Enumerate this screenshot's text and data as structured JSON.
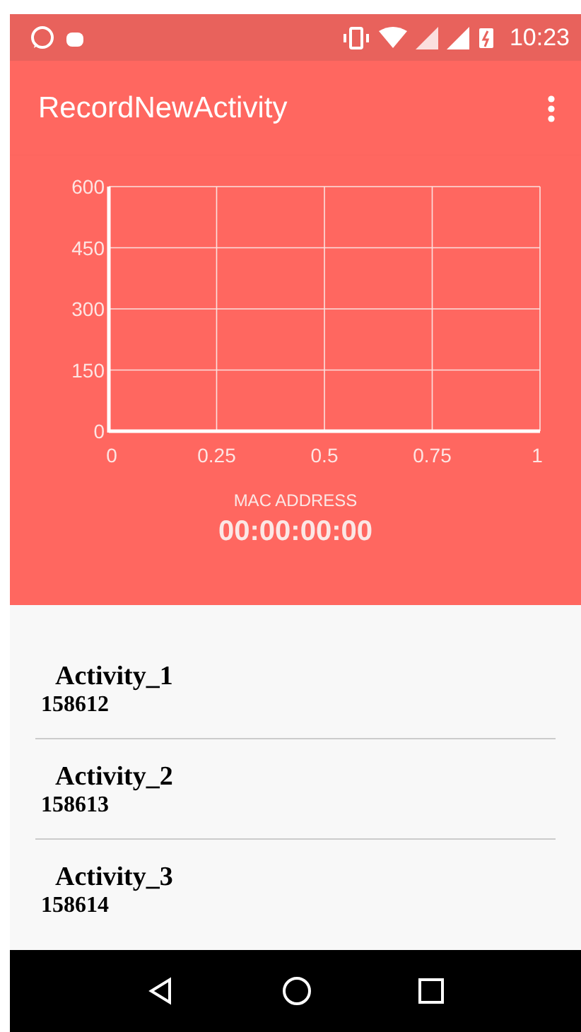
{
  "status_bar": {
    "time": "10:23"
  },
  "app_bar": {
    "title": "RecordNewActivity"
  },
  "chart": {
    "chart_data": {
      "type": "line",
      "xlim": [
        0,
        1
      ],
      "ylim": [
        0,
        600
      ],
      "xticks": [
        0,
        0.25,
        0.5,
        0.75,
        1
      ],
      "yticks": [
        0,
        150,
        300,
        450,
        600
      ],
      "grid": true
    }
  },
  "device": {
    "label": "MAC ADDRESS",
    "value": "00:00:00:00"
  },
  "activities": [
    {
      "name": "Activity_1",
      "number": "158612"
    },
    {
      "name": "Activity_2",
      "number": "158613"
    },
    {
      "name": "Activity_3",
      "number": "158614"
    }
  ]
}
